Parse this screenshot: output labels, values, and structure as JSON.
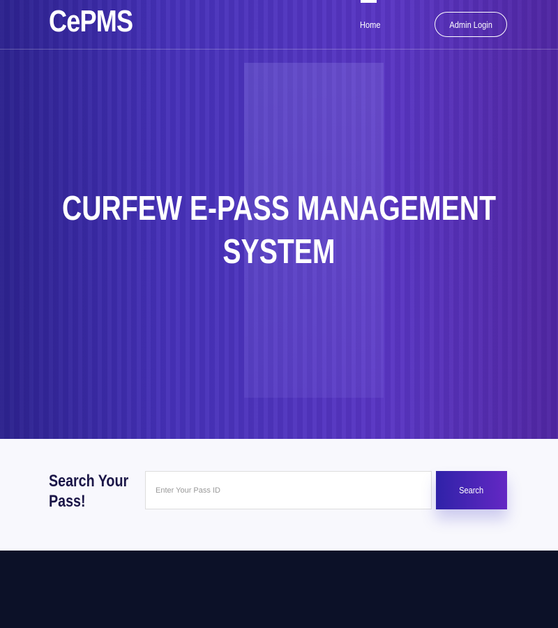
{
  "nav": {
    "logo": "CePMS",
    "home": "Home",
    "admin_login": "Admin Login"
  },
  "hero": {
    "title": "CURFEW E-PASS MANAGEMENT SYSTEM"
  },
  "search": {
    "label": "Search Your Pass!",
    "placeholder": "Enter Your Pass ID",
    "button": "Search"
  },
  "colors": {
    "accent_start": "#2f22a8",
    "accent_end": "#6428c4",
    "footer": "#0c1128"
  }
}
